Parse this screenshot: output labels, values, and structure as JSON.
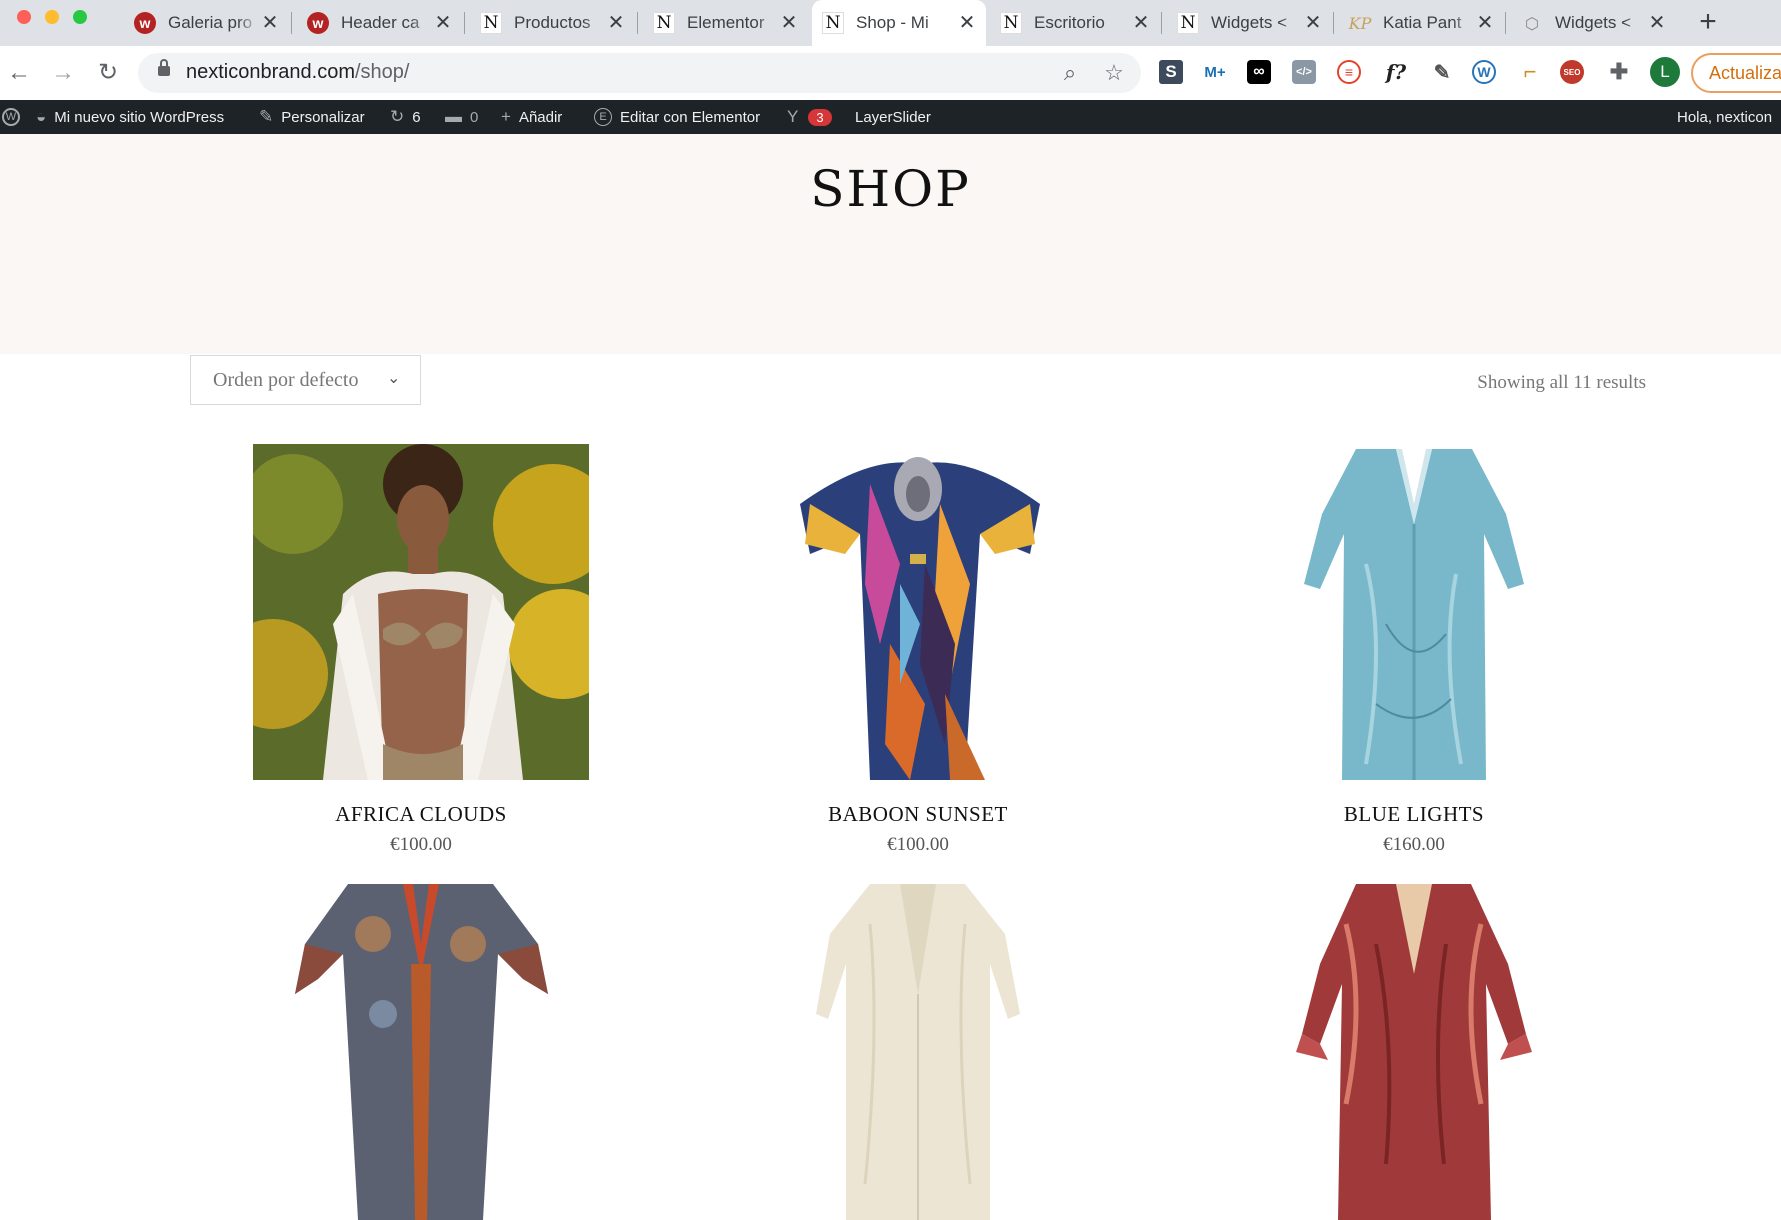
{
  "browser": {
    "tabs": [
      {
        "title": "Galeria pro",
        "favicon": "webnode-icon"
      },
      {
        "title": "Header ca",
        "favicon": "webnode-icon"
      },
      {
        "title": "Productos",
        "favicon": "nexticon-icon"
      },
      {
        "title": "Elementor",
        "favicon": "nexticon-icon"
      },
      {
        "title": "Shop - Mi",
        "favicon": "nexticon-icon",
        "active": true
      },
      {
        "title": "Escritorio",
        "favicon": "nexticon-icon"
      },
      {
        "title": "Widgets <",
        "favicon": "nexticon-icon"
      },
      {
        "title": "Katia Pant",
        "favicon": "kp-icon"
      },
      {
        "title": "Widgets <",
        "favicon": "widgets-icon"
      }
    ],
    "url": {
      "domain": "nexticonbrand.com",
      "path": "/shop/"
    },
    "update_label": "Actualizar",
    "profile_initial": "L",
    "extensions": [
      {
        "name": "s-extension-icon",
        "glyph": "S"
      },
      {
        "name": "movistar-extension-icon",
        "glyph": "M+"
      },
      {
        "name": "infinity-extension-icon",
        "glyph": "∞"
      },
      {
        "name": "code-extension-icon",
        "glyph": "</>"
      },
      {
        "name": "stream-extension-icon",
        "glyph": "≡"
      },
      {
        "name": "font-finder-extension-icon",
        "glyph": "f?"
      },
      {
        "name": "eyedropper-extension-icon",
        "glyph": "✎"
      },
      {
        "name": "wordpress-extension-icon",
        "glyph": "W"
      },
      {
        "name": "ruler-extension-icon",
        "glyph": "⌐"
      },
      {
        "name": "seo-extension-icon",
        "glyph": "SEO"
      },
      {
        "name": "puzzle-extension-icon",
        "glyph": "✚"
      }
    ]
  },
  "adminbar": {
    "site_name": "Mi nuevo sitio WordPress",
    "customize": "Personalizar",
    "updates": "6",
    "comments": "0",
    "new": "Añadir",
    "elementor": "Editar con Elementor",
    "yoast_count": "3",
    "layerslider": "LayerSlider",
    "greeting": "Hola, nexticon"
  },
  "page": {
    "title": "SHOP",
    "orderby": "Orden por defecto",
    "result_count": "Showing all 11 results",
    "products": [
      {
        "name": "Africa Clouds",
        "price": "€100.00"
      },
      {
        "name": "Baboon Sunset",
        "price": "€100.00"
      },
      {
        "name": "Blue Lights",
        "price": "€160.00"
      },
      {
        "name": "",
        "price": ""
      },
      {
        "name": "",
        "price": ""
      },
      {
        "name": "",
        "price": ""
      }
    ]
  },
  "colors": {
    "admin_bar": "#1d2327",
    "hero_bg": "#faf7f5",
    "accent_update": "#d56e0c",
    "yoast_badge": "#d63638"
  }
}
